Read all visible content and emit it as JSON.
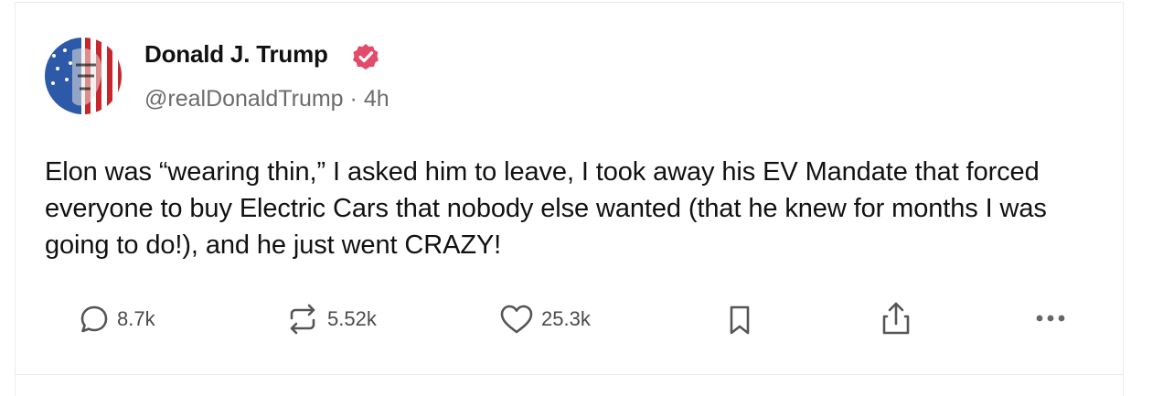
{
  "post": {
    "author_name": "Donald J. Trump",
    "handle": "@realDonaldTrump",
    "separator": "·",
    "time_ago": "4h",
    "text": "Elon was “wearing thin,” I asked him to leave, I took away his EV Mandate that forced everyone to buy Electric Cars that nobody else wanted (that he knew for months I was going to do!), and he just went CRAZY!"
  },
  "actions": {
    "replies": "8.7k",
    "retruths": "5.52k",
    "likes": "25.3k"
  },
  "icons": {
    "verified": "verified-badge-icon",
    "reply": "reply-bubble-icon",
    "retruth": "retruth-icon",
    "like": "heart-icon",
    "bookmark": "bookmark-icon",
    "share": "share-icon",
    "more": "more-dots-icon"
  },
  "colors": {
    "verified_badge": "#e34b6b",
    "text": "#111111",
    "muted": "#6b6b6b"
  }
}
